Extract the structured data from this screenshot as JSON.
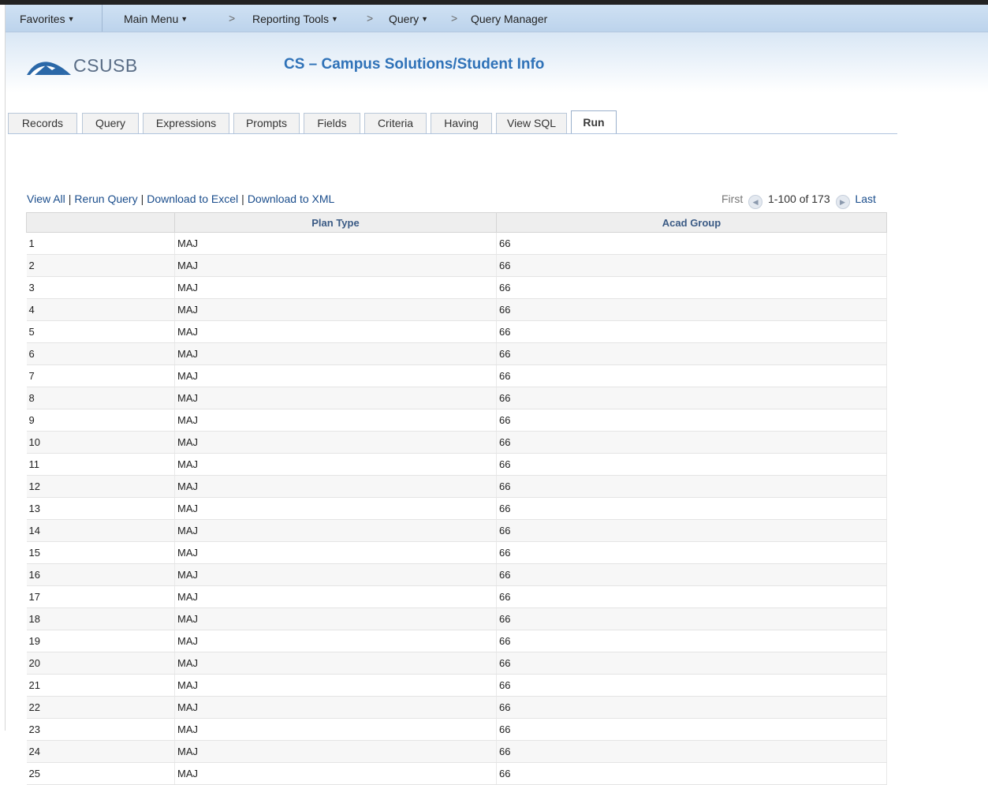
{
  "nav": {
    "favorites": "Favorites",
    "main_menu": "Main Menu",
    "reporting_tools": "Reporting Tools",
    "query": "Query",
    "query_manager": "Query Manager",
    "chevron": ">",
    "caret": "▼"
  },
  "banner": {
    "logo_text": "CSUSB",
    "title": "CS – Campus Solutions/Student Info"
  },
  "tabs": [
    "Records",
    "Query",
    "Expressions",
    "Prompts",
    "Fields",
    "Criteria",
    "Having",
    "View SQL",
    "Run"
  ],
  "active_tab": "Run",
  "actions": {
    "view_all": "View All",
    "rerun_query": "Rerun Query",
    "download_excel": "Download to Excel",
    "download_xml": "Download to XML",
    "separator": "|"
  },
  "pagination": {
    "first": "First",
    "range": "1-100 of 173",
    "last": "Last"
  },
  "table": {
    "columns": [
      "",
      "Plan Type",
      "Acad Group"
    ],
    "rows": [
      [
        "1",
        "MAJ",
        "66"
      ],
      [
        "2",
        "MAJ",
        "66"
      ],
      [
        "3",
        "MAJ",
        "66"
      ],
      [
        "4",
        "MAJ",
        "66"
      ],
      [
        "5",
        "MAJ",
        "66"
      ],
      [
        "6",
        "MAJ",
        "66"
      ],
      [
        "7",
        "MAJ",
        "66"
      ],
      [
        "8",
        "MAJ",
        "66"
      ],
      [
        "9",
        "MAJ",
        "66"
      ],
      [
        "10",
        "MAJ",
        "66"
      ],
      [
        "11",
        "MAJ",
        "66"
      ],
      [
        "12",
        "MAJ",
        "66"
      ],
      [
        "13",
        "MAJ",
        "66"
      ],
      [
        "14",
        "MAJ",
        "66"
      ],
      [
        "15",
        "MAJ",
        "66"
      ],
      [
        "16",
        "MAJ",
        "66"
      ],
      [
        "17",
        "MAJ",
        "66"
      ],
      [
        "18",
        "MAJ",
        "66"
      ],
      [
        "19",
        "MAJ",
        "66"
      ],
      [
        "20",
        "MAJ",
        "66"
      ],
      [
        "21",
        "MAJ",
        "66"
      ],
      [
        "22",
        "MAJ",
        "66"
      ],
      [
        "23",
        "MAJ",
        "66"
      ],
      [
        "24",
        "MAJ",
        "66"
      ],
      [
        "25",
        "MAJ",
        "66"
      ]
    ]
  },
  "colors": {
    "nav_bg": "#c7dcf1",
    "title_blue": "#2f72b8",
    "link_blue": "#1a4d8c",
    "header_text": "#3b5b85"
  }
}
